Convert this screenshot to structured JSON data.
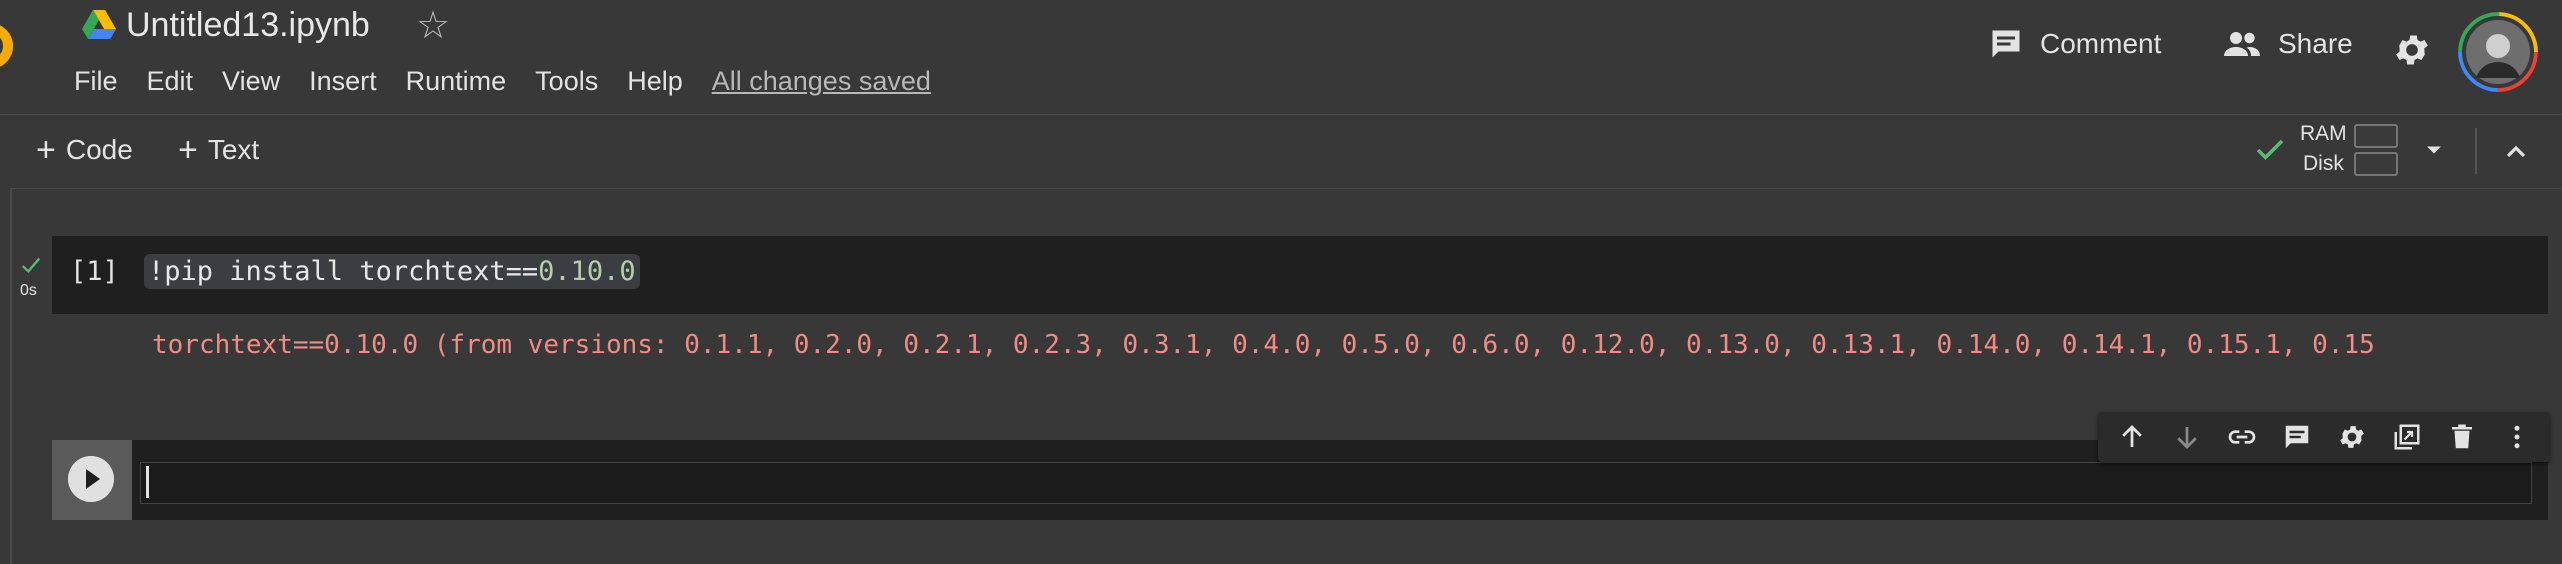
{
  "header": {
    "title": "Untitled13.ipynb",
    "menu": [
      "File",
      "Edit",
      "View",
      "Insert",
      "Runtime",
      "Tools",
      "Help"
    ],
    "save_status": "All changes saved",
    "comment_label": "Comment",
    "share_label": "Share"
  },
  "toolbar": {
    "add_code_label": "Code",
    "add_text_label": "Text",
    "ram_label": "RAM",
    "disk_label": "Disk"
  },
  "cells": [
    {
      "execution_count": "[1]",
      "exec_time": "0s",
      "code_command": "!pip install torchtext==",
      "code_version": "0.10.0",
      "output": "torchtext==0.10.0 (from versions: 0.1.1, 0.2.0, 0.2.1, 0.2.3, 0.3.1, 0.4.0, 0.5.0, 0.6.0, 0.12.0, 0.13.0, 0.13.1, 0.14.0, 0.14.1, 0.15.1, 0.15"
    },
    {
      "code": ""
    }
  ],
  "cell_toolbar_icons": [
    "arrow-up-icon",
    "arrow-down-icon",
    "link-icon",
    "comment-icon",
    "settings-icon",
    "mirror-cell-icon",
    "delete-icon",
    "more-vert-icon"
  ],
  "colors": {
    "background": "#383838",
    "cell_background": "#1f1f1f",
    "error_text": "#f28b82",
    "success_check": "#5bb974",
    "accent": "#f9ab00"
  }
}
